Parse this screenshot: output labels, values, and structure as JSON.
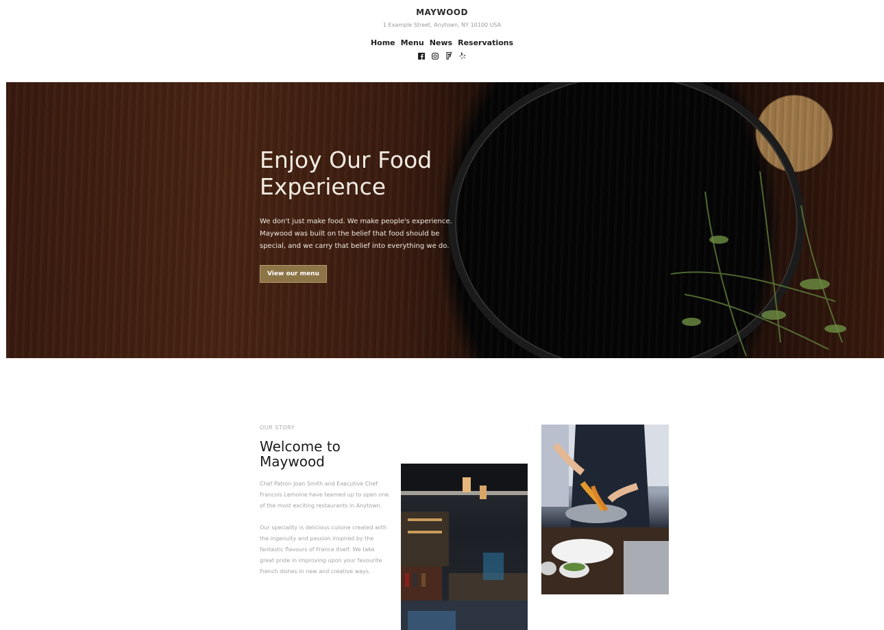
{
  "header": {
    "brand": "MAYWOOD",
    "address": "1 Example Street, Anytown, NY 10100 USA",
    "nav": [
      "Home",
      "Menu",
      "News",
      "Reservations"
    ],
    "social_icons": [
      "facebook-icon",
      "instagram-icon",
      "foursquare-icon",
      "yelp-icon"
    ]
  },
  "hero": {
    "title": "Enjoy Our Food Experience",
    "text": "We don't just make food. We make people's experience. Maywood was built on the belief that food should be special, and we carry that belief into everything we do.",
    "button": "View our menu"
  },
  "story": {
    "eyebrow": "OUR STORY",
    "title": "Welcome to Maywood",
    "paragraph1": "Chef Patron Joan Smith and Executive Chef Francois Lemoine have teamed up to open one of the most exciting restaurants in Anytown.",
    "paragraph2": "Our speciality is delicious cuisine created with the ingenuity and passion inspired by the fantastic flavours of France itself. We take great pride in improving upon your favourite French dishes in new and creative ways."
  },
  "colors": {
    "button_bg": "#8d7447",
    "hero_text": "#f3ece3",
    "muted_text": "#a3a3a3"
  }
}
